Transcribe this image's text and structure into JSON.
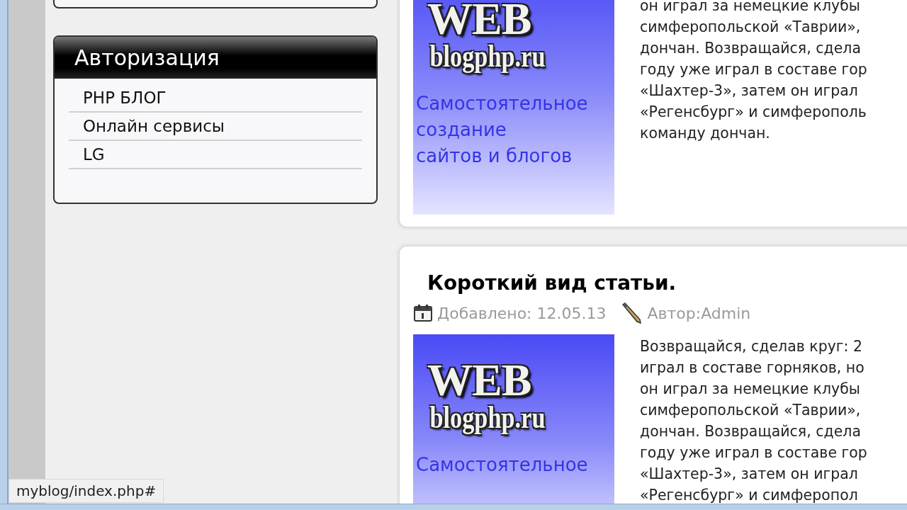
{
  "sidebar": {
    "auth_panel": {
      "title": "Авторизация",
      "links": [
        "PHP БЛОГ",
        "Онлайн сервисы",
        "LG"
      ]
    }
  },
  "articles": [
    {
      "banner": {
        "title": "WEB",
        "subtitle": "blogphp.ru",
        "tagline": [
          "Самостоятельное",
          "создание",
          "сайтов и блогов"
        ]
      },
      "text_lines": [
        "он играл за немецкие клубы",
        "симферопольской «Таврии»,",
        "дончан. Возвращайся, сдела",
        "году уже играл в составе гор",
        "«Шахтер-3», затем он играл",
        "«Регенсбург» и симферополь",
        "команду дончан."
      ]
    },
    {
      "title": "Короткий вид статьи.",
      "date": "Добавлено: 12.05.13",
      "author": "Автор:Admin",
      "banner": {
        "title": "WEB",
        "subtitle": "blogphp.ru",
        "tagline": [
          "Самостоятельное"
        ]
      },
      "text_lines": [
        "Возвращайся, сделав круг: 2",
        "играл в составе горняков, но",
        "он играл за немецкие клубы",
        "симферопольской «Таврии»,",
        "дончан. Возвращайся, сдела",
        "году уже играл в составе гор",
        "«Шахтер-3», затем он играл",
        "«Регенсбург» и симферопол"
      ]
    }
  ],
  "status_bar": {
    "url": "myblog/index.php#"
  }
}
